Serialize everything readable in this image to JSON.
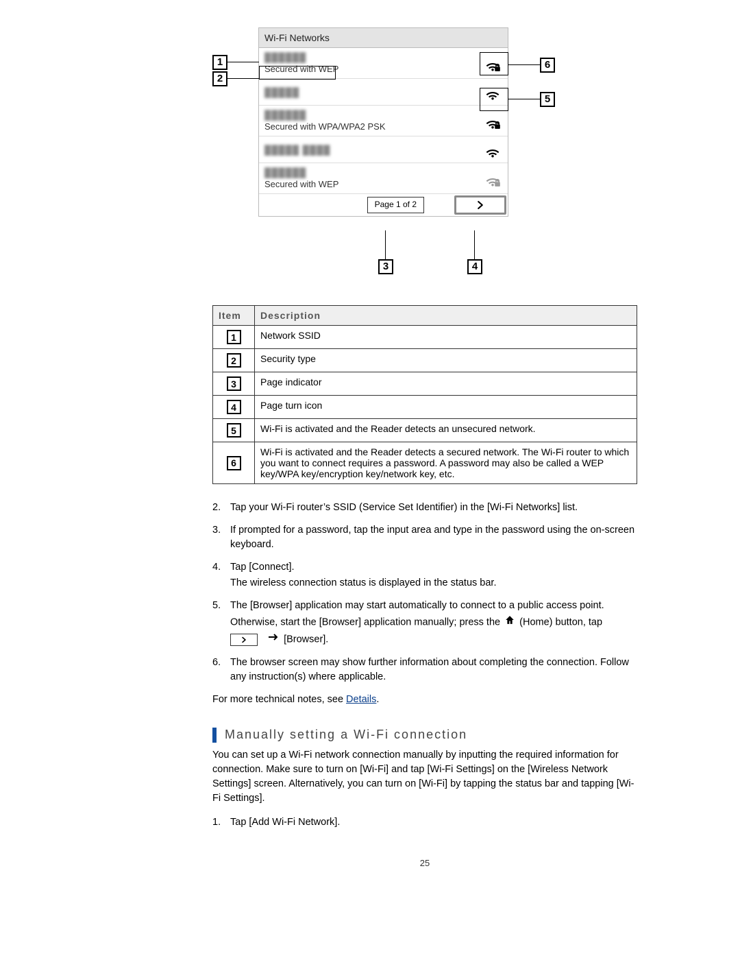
{
  "figure": {
    "header": "Wi-Fi Networks",
    "rows": [
      {
        "ssid_blur": "██████",
        "security": "Secured with WEP",
        "icon": "lock"
      },
      {
        "ssid_blur": "█████",
        "security": "",
        "icon": "open"
      },
      {
        "ssid_blur": "██████",
        "security": "Secured with WPA/WPA2 PSK",
        "icon": "lock"
      },
      {
        "ssid_blur": "█████ ████",
        "security": "",
        "icon": "open"
      },
      {
        "ssid_blur": "██████",
        "security": "Secured with WEP",
        "icon": "lockfaint"
      }
    ],
    "page_indicator": "Page 1 of 2"
  },
  "callouts": {
    "c1": "1",
    "c2": "2",
    "c3": "3",
    "c4": "4",
    "c5": "5",
    "c6": "6"
  },
  "table": {
    "head_item": "Item",
    "head_desc": "Description",
    "rows": [
      {
        "n": "1",
        "d": "Network SSID"
      },
      {
        "n": "2",
        "d": "Security type"
      },
      {
        "n": "3",
        "d": "Page indicator"
      },
      {
        "n": "4",
        "d": "Page turn icon"
      },
      {
        "n": "5",
        "d": "Wi-Fi is activated and the Reader detects an unsecured network."
      },
      {
        "n": "6",
        "d": "Wi-Fi is activated and the Reader detects a secured network. The Wi-Fi router to which you want to connect requires a password. A password may also be called a WEP key/WPA key/encryption key/network key, etc."
      }
    ]
  },
  "steps": {
    "s2": "Tap your Wi-Fi router’s SSID (Service Set Identifier) in the [Wi-Fi Networks] list.",
    "s3": "If prompted for a password, tap the input area and type in the password using the on-screen keyboard.",
    "s4a": "Tap [Connect].",
    "s4b": "The wireless connection status is displayed in the status bar.",
    "s5a": "The [Browser] application may start automatically to connect to a public access point.",
    "s5b_pre": "Otherwise, start the [Browser] application manually; press the ",
    "s5b_post": " (Home) button, tap",
    "s5c": " [Browser].",
    "s6": "The browser screen may show further information about completing the connection. Follow any instruction(s) where applicable."
  },
  "tech_note_pre": "For more technical notes, see ",
  "tech_note_link": "Details",
  "tech_note_post": ".",
  "section_heading": "Manually setting a Wi-Fi connection",
  "section_body": "You can set up a Wi-Fi network connection manually by inputting the required information for connection. Make sure to turn on [Wi-Fi] and tap [Wi-Fi Settings] on the [Wireless Network Settings] screen. Alternatively, you can turn on [Wi-Fi] by tapping the status bar and tapping [Wi-Fi Settings].",
  "manual_step1": "Tap [Add Wi-Fi Network].",
  "page_number": "25"
}
